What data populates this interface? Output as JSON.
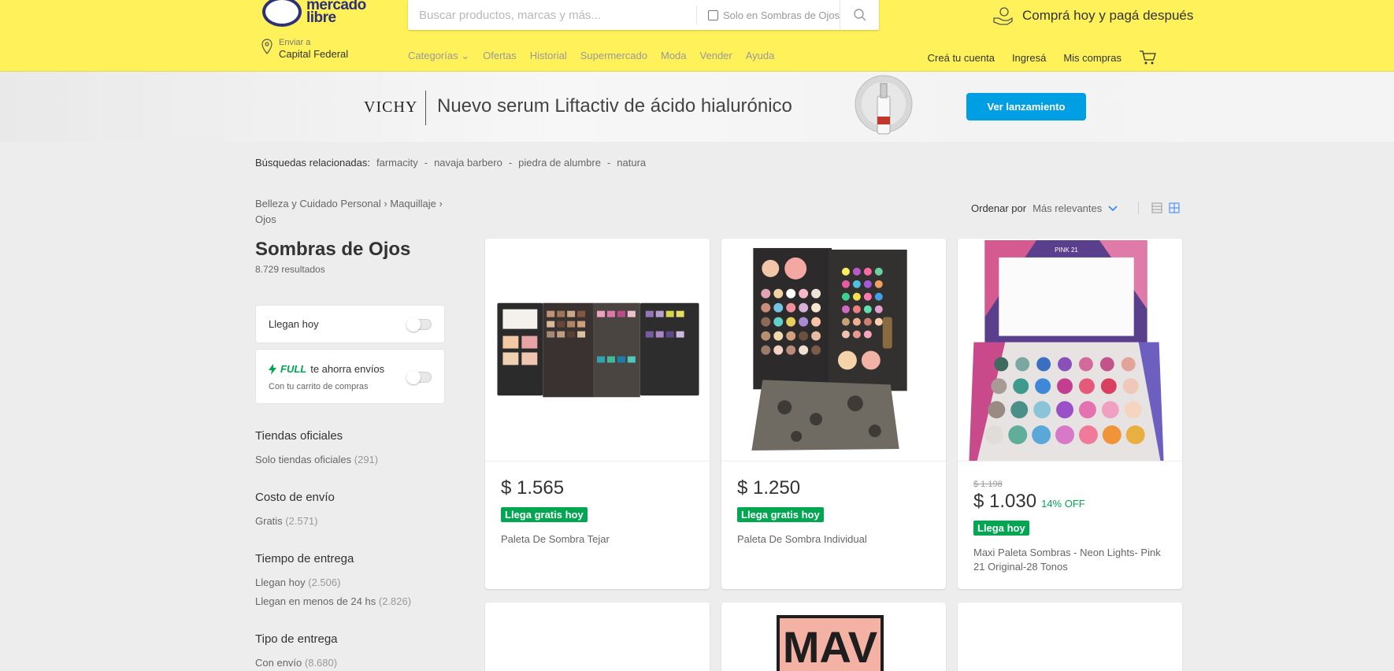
{
  "header": {
    "logo_line1": "mercado",
    "logo_line2": "libre",
    "search_placeholder": "Buscar productos, marcas y más...",
    "search_checkbox_label": "Solo en Sombras de Ojos",
    "promo": "Comprá hoy y pagá después",
    "location_label": "Enviar a",
    "location_value": "Capital Federal",
    "nav": [
      "Categorías",
      "Ofertas",
      "Historial",
      "Supermercado",
      "Moda",
      "Vender",
      "Ayuda"
    ],
    "account": [
      "Creá tu cuenta",
      "Ingresá",
      "Mis compras"
    ]
  },
  "banner": {
    "brand": "VICHY",
    "title": "Nuevo serum Liftactiv de ácido hialurónico",
    "button": "Ver lanzamiento"
  },
  "related": {
    "label": "Búsquedas relacionadas:",
    "items": [
      "farmacity",
      "navaja barbero",
      "piedra de alumbre",
      "natura"
    ]
  },
  "breadcrumb": [
    "Belleza y Cuidado Personal",
    "Maquillaje",
    "Ojos"
  ],
  "sort": {
    "label": "Ordenar por",
    "value": "Más relevantes"
  },
  "page": {
    "title": "Sombras de Ojos",
    "results": "8.729 resultados"
  },
  "filters": {
    "today_toggle": "Llegan hoy",
    "full_badge": "FULL",
    "full_text": "te ahorra envíos",
    "full_sub": "Con tu carrito de compras",
    "sections": [
      {
        "title": "Tiendas oficiales",
        "items": [
          {
            "label": "Solo tiendas oficiales",
            "count": "(291)"
          }
        ]
      },
      {
        "title": "Costo de envío",
        "items": [
          {
            "label": "Gratis",
            "count": "(2.571)"
          }
        ]
      },
      {
        "title": "Tiempo de entrega",
        "items": [
          {
            "label": "Llegan hoy",
            "count": "(2.506)"
          },
          {
            "label": "Llegan en menos de 24 hs",
            "count": "(2.826)"
          }
        ]
      },
      {
        "title": "Tipo de entrega",
        "items": [
          {
            "label": "Con envío",
            "count": "(8.680)"
          }
        ]
      }
    ]
  },
  "products": [
    {
      "price": "$ 1.565",
      "tag": "Llega gratis hoy",
      "title": "Paleta De Sombra Tejar"
    },
    {
      "price": "$ 1.250",
      "tag": "Llega gratis hoy",
      "title": "Paleta De Sombra Individual"
    },
    {
      "old_price": "$ 1.198",
      "price": "$ 1.030",
      "discount": "14% OFF",
      "tag": "Llega hoy",
      "title": "Maxi Paleta Sombras - Neon Lights- Pink 21 Original-28 Tonos",
      "img_label": "PINK 21"
    }
  ],
  "partial_card_text": "MAV"
}
